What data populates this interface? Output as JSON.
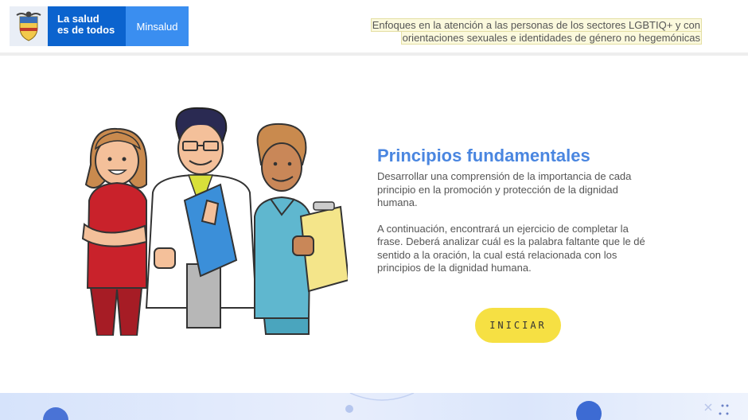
{
  "header": {
    "brand": {
      "line1": "La salud",
      "line2": "es de todos",
      "name": "Minsalud"
    },
    "course_title_line1": "Enfoques en la atención a las personas de los sectores LGBTIQ+ y con",
    "course_title_line2": "orientaciones sexuales e identidades de género no hegemónicas"
  },
  "main": {
    "title": "Principios fundamentales",
    "paragraph1": "Desarrollar una comprensión de la importancia de cada principio en la promoción y protección de la dignidad humana.",
    "paragraph2": "A continuación, encontrará un ejercicio de completar la frase. Deberá analizar cuál es la palabra faltante que le dé sentido a la oración, la cual está relacionada con los principios de la dignidad humana.",
    "start_label": "INICIAR"
  },
  "colors": {
    "brand_blue": "#0b63ce",
    "brand_light_blue": "#3a8ef0",
    "title_blue": "#4a86e0",
    "button_yellow": "#f6e043"
  }
}
